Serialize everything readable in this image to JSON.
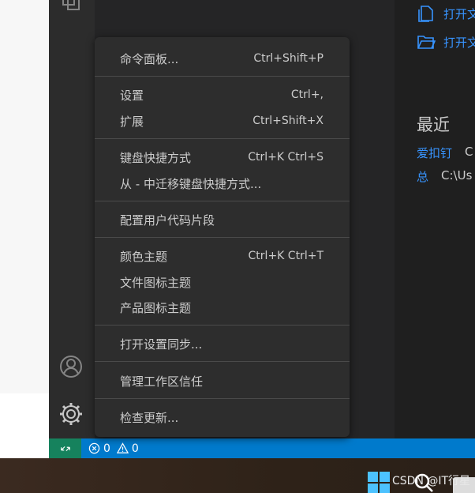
{
  "menu": {
    "items": [
      {
        "label": "命令面板...",
        "shortcut": "Ctrl+Shift+P"
      },
      {
        "label": "设置",
        "shortcut": "Ctrl+,"
      },
      {
        "label": "扩展",
        "shortcut": "Ctrl+Shift+X"
      },
      {
        "label": "键盘快捷方式",
        "shortcut": "Ctrl+K Ctrl+S"
      },
      {
        "label": "从 - 中迁移键盘快捷方式...",
        "shortcut": ""
      },
      {
        "label": "配置用户代码片段",
        "shortcut": ""
      },
      {
        "label": "颜色主题",
        "shortcut": "Ctrl+K Ctrl+T"
      },
      {
        "label": "文件图标主题",
        "shortcut": ""
      },
      {
        "label": "产品图标主题",
        "shortcut": ""
      },
      {
        "label": "打开设置同步...",
        "shortcut": ""
      },
      {
        "label": "管理工作区信任",
        "shortcut": ""
      },
      {
        "label": "检查更新...",
        "shortcut": ""
      }
    ]
  },
  "welcome": {
    "open_file": "打开文",
    "open_folder": "打开文",
    "recent_title": "最近",
    "recent": [
      {
        "name": "爱扣钉",
        "path": "C"
      },
      {
        "name": "总",
        "path": "C:\\Us"
      }
    ]
  },
  "statusbar": {
    "errors": "0",
    "warnings": "0"
  },
  "taskbar": {
    "watermark": "CSDN @IT行星"
  },
  "colors": {
    "accent": "#007acc",
    "remote": "#16825d",
    "link": "#3794ff",
    "menu_bg": "#2d2d2d"
  },
  "icons": [
    "accounts-icon",
    "manage-gear-icon",
    "open-file-icon",
    "open-folder-icon",
    "remote-icon",
    "error-icon",
    "warning-icon",
    "windows-start-icon",
    "search-icon"
  ]
}
